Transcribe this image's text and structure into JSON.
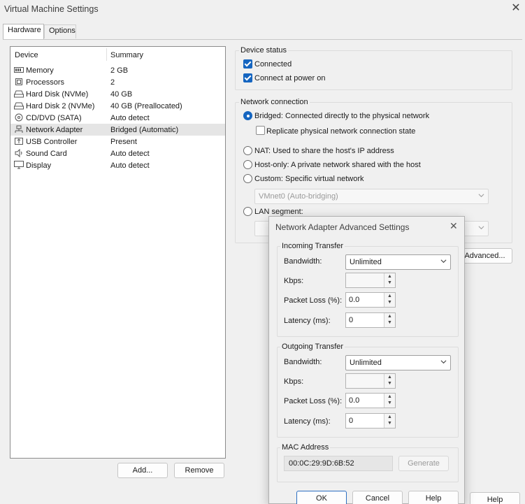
{
  "window": {
    "title": "Virtual Machine Settings",
    "close": "✕"
  },
  "tabs": [
    {
      "label": "Hardware"
    },
    {
      "label": "Options"
    }
  ],
  "device_list": {
    "headers": {
      "device": "Device",
      "summary": "Summary"
    },
    "rows": [
      {
        "name": "Memory",
        "summary": "2 GB",
        "icon": "memory-icon"
      },
      {
        "name": "Processors",
        "summary": "2",
        "icon": "processor-icon"
      },
      {
        "name": "Hard Disk (NVMe)",
        "summary": "40 GB",
        "icon": "hard-disk-icon"
      },
      {
        "name": "Hard Disk 2 (NVMe)",
        "summary": "40 GB (Preallocated)",
        "icon": "hard-disk-icon"
      },
      {
        "name": "CD/DVD (SATA)",
        "summary": "Auto detect",
        "icon": "cd-dvd-icon"
      },
      {
        "name": "Network Adapter",
        "summary": "Bridged (Automatic)",
        "icon": "network-adapter-icon",
        "selected": true
      },
      {
        "name": "USB Controller",
        "summary": "Present",
        "icon": "usb-icon"
      },
      {
        "name": "Sound Card",
        "summary": "Auto detect",
        "icon": "sound-card-icon"
      },
      {
        "name": "Display",
        "summary": "Auto detect",
        "icon": "display-icon"
      }
    ]
  },
  "buttons": {
    "add": "Add...",
    "remove": "Remove",
    "advanced": "Advanced...",
    "help": "Help"
  },
  "device_status": {
    "label": "Device status",
    "connected": "Connected",
    "connect_at_power_on": "Connect at power on"
  },
  "network_connection": {
    "label": "Network connection",
    "bridged": "Bridged: Connected directly to the physical network",
    "replicate": "Replicate physical network connection state",
    "nat": "NAT: Used to share the host's IP address",
    "host_only": "Host-only: A private network shared with the host",
    "custom": "Custom: Specific virtual network",
    "custom_value": "VMnet0 (Auto-bridging)",
    "lan_segment": "LAN segment:",
    "lan_value": ""
  },
  "advanced_dialog": {
    "title": "Network Adapter Advanced Settings",
    "close": "✕",
    "incoming": {
      "label": "Incoming Transfer",
      "bandwidth_label": "Bandwidth:",
      "bandwidth": "Unlimited",
      "kbps_label": "Kbps:",
      "kbps": "",
      "loss_label": "Packet Loss (%):",
      "loss": "0.0",
      "latency_label": "Latency (ms):",
      "latency": "0"
    },
    "outgoing": {
      "label": "Outgoing Transfer",
      "bandwidth_label": "Bandwidth:",
      "bandwidth": "Unlimited",
      "kbps_label": "Kbps:",
      "kbps": "",
      "loss_label": "Packet Loss (%):",
      "loss": "0.0",
      "latency_label": "Latency (ms):",
      "latency": "0"
    },
    "mac": {
      "label": "MAC Address",
      "value": "00:0C:29:9D:6B:52",
      "generate": "Generate"
    },
    "ok": "OK",
    "cancel": "Cancel",
    "help": "Help"
  }
}
